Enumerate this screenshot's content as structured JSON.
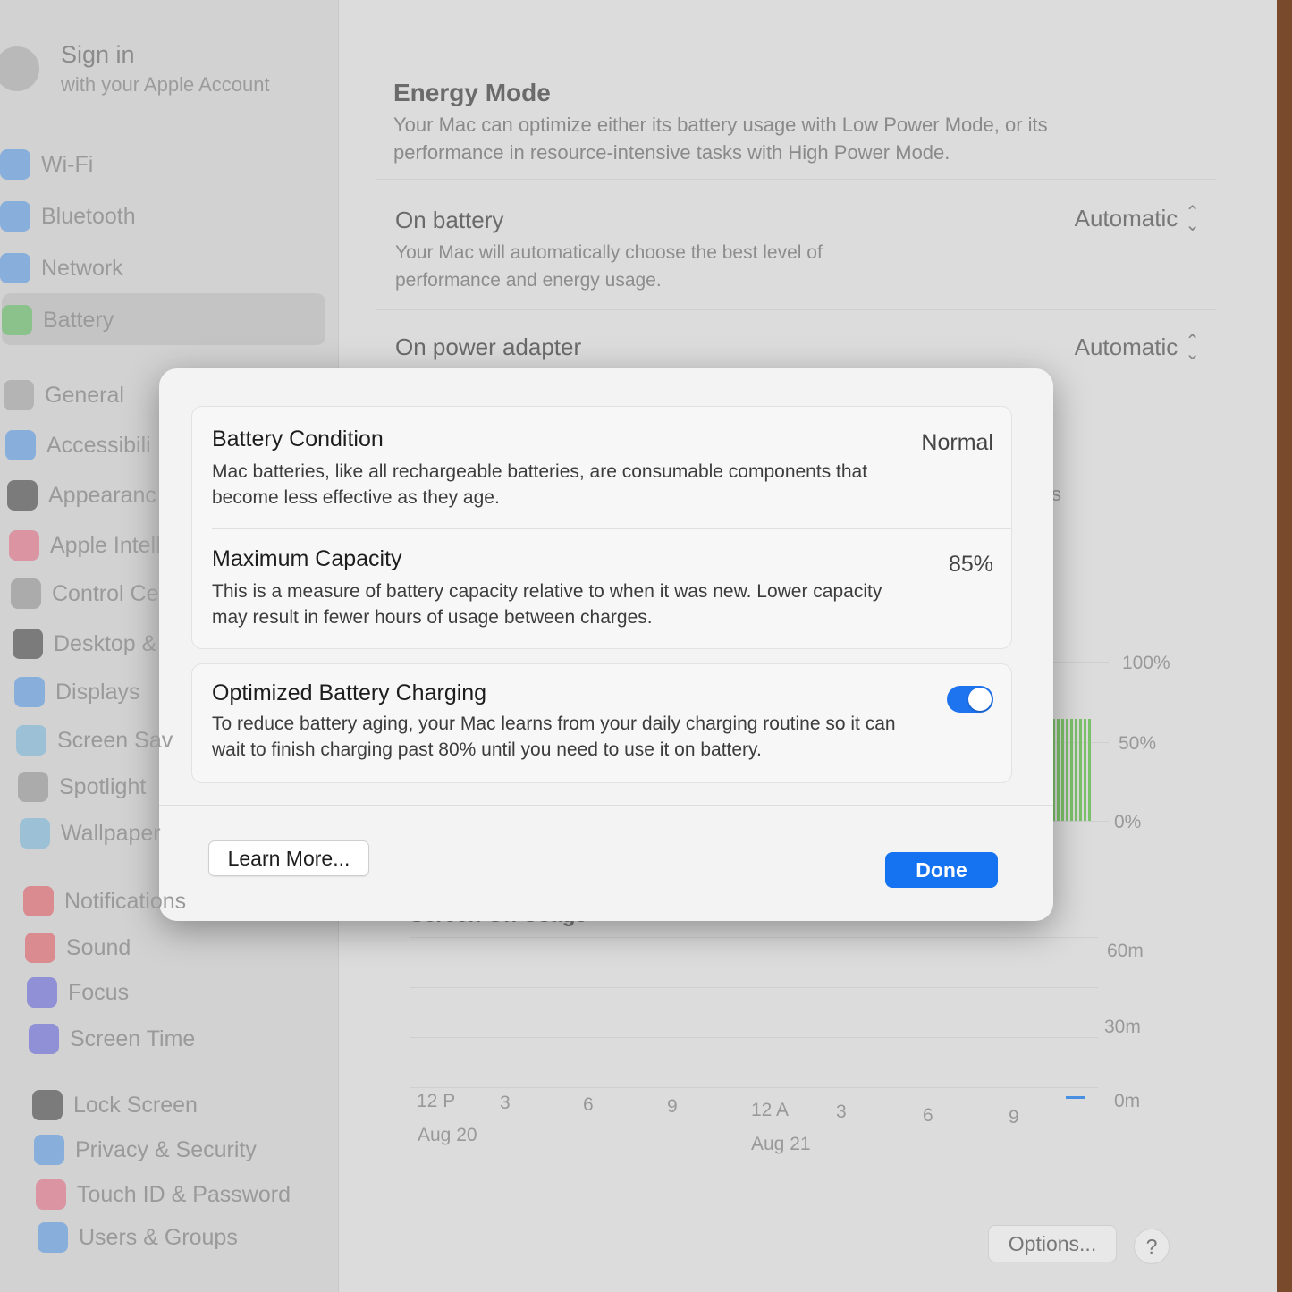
{
  "sidebar": {
    "account": {
      "name": "Sign in",
      "subtitle": "with your Apple Account"
    },
    "items": [
      {
        "label": "Wi-Fi",
        "icon": "wifi-icon",
        "color": "#4a90e2"
      },
      {
        "label": "Bluetooth",
        "icon": "bluetooth-icon",
        "color": "#4a90e2"
      },
      {
        "label": "Network",
        "icon": "globe-icon",
        "color": "#4a90e2"
      },
      {
        "label": "Battery",
        "icon": "battery-icon",
        "color": "#5cc05c",
        "selected": true
      },
      {
        "label": "General",
        "icon": "gear-icon",
        "color": "#9a9a9a"
      },
      {
        "label": "Accessibili",
        "icon": "accessibility-icon",
        "color": "#4a90e2"
      },
      {
        "label": "Appearanc",
        "icon": "appearance-icon",
        "color": "#333333"
      },
      {
        "label": "Apple Intell",
        "icon": "apple-intelligence-icon",
        "color": "#e0607a"
      },
      {
        "label": "Control Ce",
        "icon": "control-center-icon",
        "color": "#8a8a8a"
      },
      {
        "label": "Desktop &",
        "icon": "desktop-dock-icon",
        "color": "#333333"
      },
      {
        "label": "Displays",
        "icon": "displays-icon",
        "color": "#4a90e2"
      },
      {
        "label": "Screen Sav",
        "icon": "screen-saver-icon",
        "color": "#6fb3d9"
      },
      {
        "label": "Spotlight",
        "icon": "spotlight-icon",
        "color": "#8a8a8a"
      },
      {
        "label": "Wallpaper",
        "icon": "wallpaper-icon",
        "color": "#6fb3d9"
      },
      {
        "label": "Notifications",
        "icon": "notifications-icon",
        "color": "#e0505a"
      },
      {
        "label": "Sound",
        "icon": "sound-icon",
        "color": "#e0505a"
      },
      {
        "label": "Focus",
        "icon": "focus-icon",
        "color": "#5a5ad8"
      },
      {
        "label": "Screen Time",
        "icon": "screen-time-icon",
        "color": "#5a5ad8"
      },
      {
        "label": "Lock Screen",
        "icon": "lock-icon",
        "color": "#333333"
      },
      {
        "label": "Privacy & Security",
        "icon": "hand-icon",
        "color": "#4a90e2"
      },
      {
        "label": "Touch ID & Password",
        "icon": "fingerprint-icon",
        "color": "#e0607a"
      },
      {
        "label": "Users & Groups",
        "icon": "users-icon",
        "color": "#4a90e2"
      }
    ]
  },
  "energy_mode": {
    "title": "Energy Mode",
    "description": "Your Mac can optimize either its battery usage with Low Power Mode, or its performance in resource-intensive tasks with High Power Mode.",
    "on_battery": {
      "label": "On battery",
      "value": "Automatic",
      "description": "Your Mac will automatically choose the best level of performance and energy usage."
    },
    "on_power_adapter": {
      "label": "On power adapter",
      "value": "Automatic"
    }
  },
  "behind_fragment": "s",
  "battery_level_chart": {
    "ticks": [
      "100%",
      "50%",
      "0%"
    ],
    "bar_color": "#7cc26a"
  },
  "screen_on_usage": {
    "title": "Screen On Usage",
    "y_ticks": [
      "60m",
      "30m",
      "0m"
    ],
    "x_ticks": [
      "12 P",
      "3",
      "6",
      "9",
      "12 A",
      "3",
      "6",
      "9"
    ],
    "dates": [
      "Aug 20",
      "Aug 21"
    ]
  },
  "buttons": {
    "options": "Options...",
    "help": "?"
  },
  "modal": {
    "battery_condition": {
      "title": "Battery Condition",
      "value": "Normal",
      "description": "Mac batteries, like all rechargeable batteries, are consumable components that become less effective as they age."
    },
    "maximum_capacity": {
      "title": "Maximum Capacity",
      "value": "85%",
      "description": "This is a measure of battery capacity relative to when it was new. Lower capacity may result in fewer hours of usage between charges."
    },
    "optimized_charging": {
      "title": "Optimized Battery Charging",
      "enabled": true,
      "description": "To reduce battery aging, your Mac learns from your daily charging routine so it can wait to finish charging past 80% until you need to use it on battery."
    },
    "learn_more": "Learn More...",
    "done": "Done",
    "accent": "#1572f0"
  }
}
